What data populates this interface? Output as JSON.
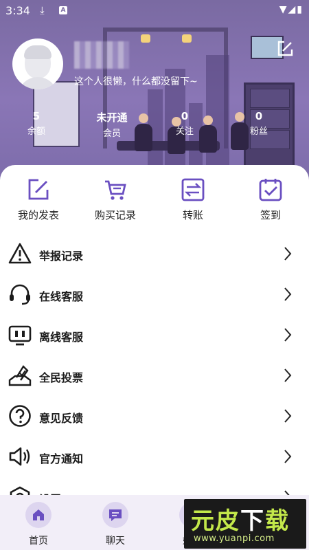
{
  "status_bar": {
    "time": "3:34",
    "download_glyph": "⤓",
    "app_badge": "A",
    "right_glyphs": "▼◢▮"
  },
  "profile": {
    "signature": "这个人很懒，什么都没留下~"
  },
  "stats": [
    {
      "value": "5",
      "label": "余额"
    },
    {
      "value": "未开通",
      "label": "会员"
    },
    {
      "value": "0",
      "label": "关注"
    },
    {
      "value": "0",
      "label": "粉丝"
    }
  ],
  "quick_actions": [
    {
      "label": "我的发表",
      "icon": "edit-icon"
    },
    {
      "label": "购买记录",
      "icon": "cart-icon"
    },
    {
      "label": "转账",
      "icon": "transfer-icon"
    },
    {
      "label": "签到",
      "icon": "checkin-icon"
    }
  ],
  "menu": [
    {
      "label": "举报记录",
      "icon": "warning-icon"
    },
    {
      "label": "在线客服",
      "icon": "headset-icon"
    },
    {
      "label": "离线客服",
      "icon": "monitor-icon"
    },
    {
      "label": "全民投票",
      "icon": "vote-icon"
    },
    {
      "label": "意见反馈",
      "icon": "question-icon"
    },
    {
      "label": "官方通知",
      "icon": "speaker-icon"
    },
    {
      "label": "设置",
      "icon": "settings-icon"
    }
  ],
  "bottom_nav": [
    {
      "label": "首页",
      "icon": "home-icon"
    },
    {
      "label": "聊天",
      "icon": "chat-icon"
    },
    {
      "label": "好友",
      "icon": "friends-icon"
    }
  ],
  "watermark": {
    "big_a": "元皮",
    "big_b": "下",
    "big_c": "载",
    "url": "www.yuanpi.com"
  },
  "colors": {
    "accent": "#6a4fc1",
    "header": "#8a76b6",
    "nav_bg": "#f2eef8"
  }
}
